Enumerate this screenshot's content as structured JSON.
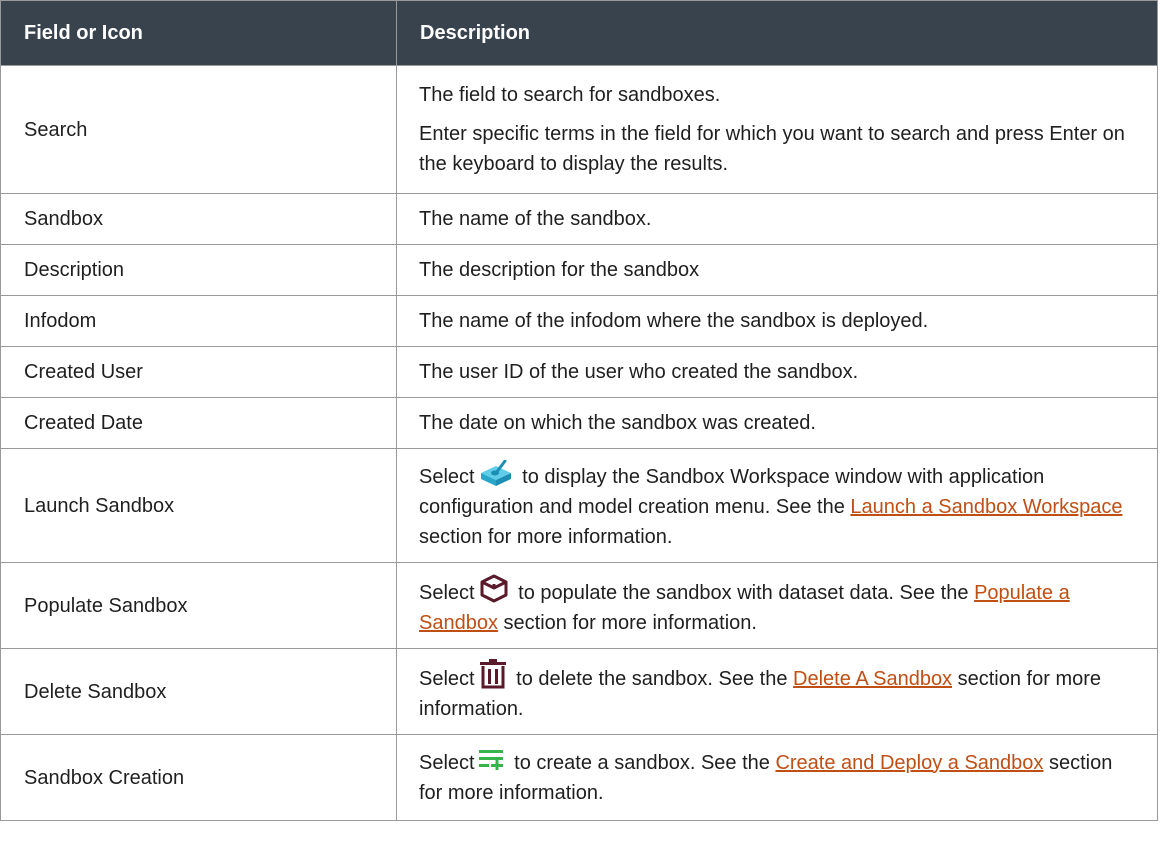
{
  "table": {
    "headers": {
      "field": "Field or Icon",
      "description": "Description"
    },
    "rows": [
      {
        "field": "Search",
        "desc_p1": "The field to search for sandboxes.",
        "desc_p2": "Enter specific terms in the field for which you want to search and press Enter on the keyboard to display the results."
      },
      {
        "field": "Sandbox",
        "desc": "The name of the sandbox."
      },
      {
        "field": "Description",
        "desc": "The description for the sandbox"
      },
      {
        "field": "Infodom",
        "desc": "The name of the infodom where the sandbox is deployed."
      },
      {
        "field": "Created User",
        "desc": "The user ID of the user who created the sandbox."
      },
      {
        "field": "Created Date",
        "desc": "The date on which the sandbox was created."
      },
      {
        "field": "Launch Sandbox",
        "pre": "Select",
        "mid": "to display the Sandbox Workspace window with application configuration and model creation menu. See the",
        "link": "Launch a Sandbox Workspace",
        "post": "section for more information.",
        "icon": "launch-sandbox-icon"
      },
      {
        "field": "Populate Sandbox",
        "pre": "Select",
        "mid": "to populate the sandbox with dataset data. See the",
        "link": "Populate a Sandbox",
        "post": "section for more information.",
        "icon": "populate-sandbox-icon"
      },
      {
        "field": "Delete Sandbox",
        "pre": "Select",
        "mid": "to delete the sandbox. See the",
        "link": "Delete A Sandbox",
        "post": "section for more information.",
        "icon": "trash-icon"
      },
      {
        "field": "Sandbox Creation",
        "pre": "Select",
        "mid": "to create a sandbox. See the",
        "link": "Create and Deploy a Sandbox",
        "post": "section for more information.",
        "icon": "list-add-icon"
      }
    ]
  },
  "colors": {
    "header_bg": "#39434e",
    "link": "#c04f14",
    "launch_icon": "#3bb7d8",
    "populate_icon": "#5a1a2a",
    "delete_icon": "#5a1a2a",
    "create_icon": "#36b34a"
  }
}
